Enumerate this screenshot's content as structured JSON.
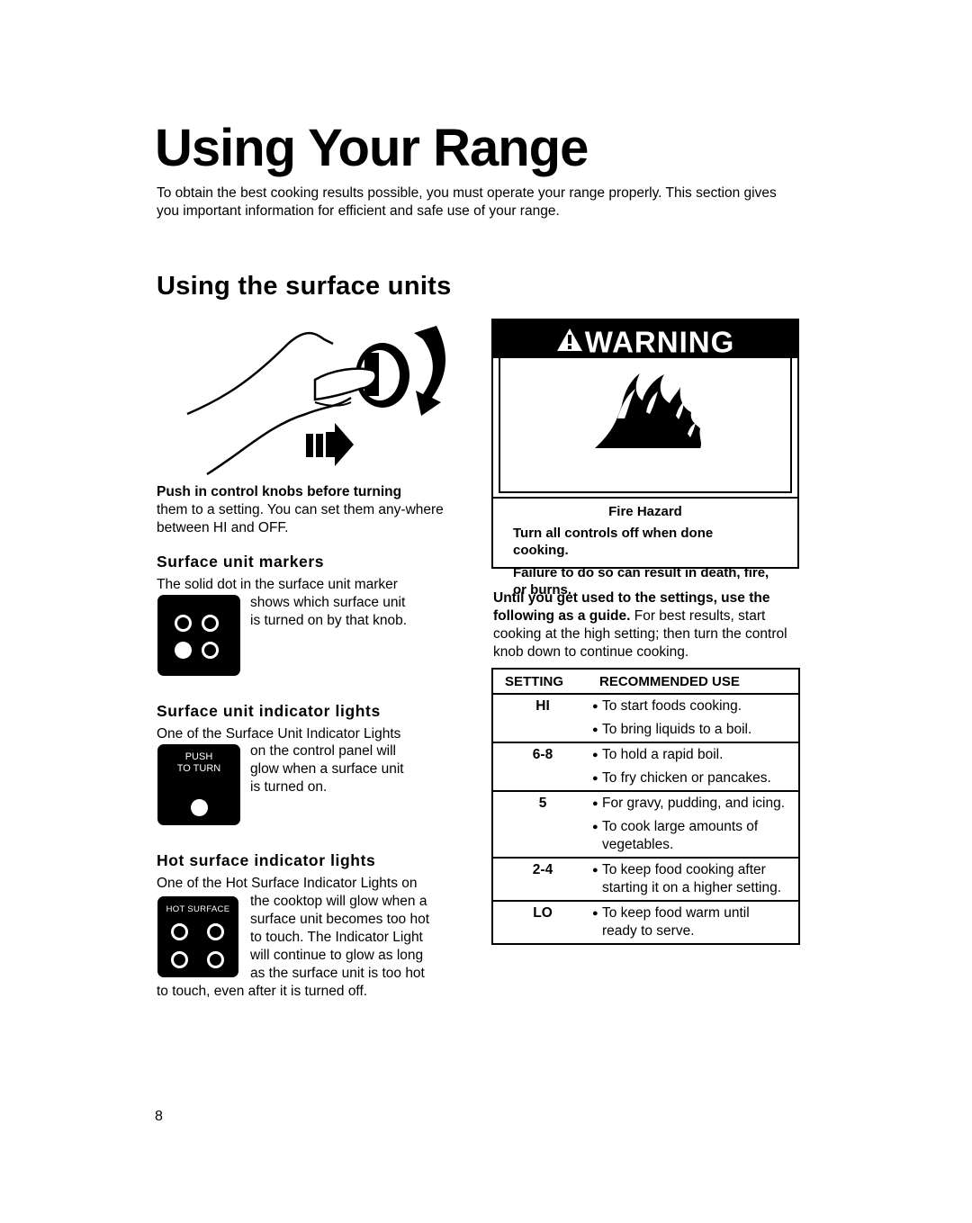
{
  "page": {
    "title": "Using Your Range",
    "intro": "To obtain the best cooking results possible, you must operate your range properly. This section gives you important information for efficient and safe use of your range.",
    "section_title": "Using the surface units",
    "page_number": "8"
  },
  "knob": {
    "illustration_icon": "hand-pushing-knob-icon",
    "caption_bold": "Push in control knobs before turning",
    "caption_rest": "them to a setting. You can set them any-where between HI and OFF."
  },
  "markers": {
    "heading": "Surface unit markers",
    "line1": "The solid dot in the surface unit marker",
    "line2": "shows which surface unit",
    "line3": "is turned on by that knob.",
    "icon": "surface-unit-marker-icon"
  },
  "indicator": {
    "heading": "Surface unit indicator lights",
    "line1": "One of the Surface Unit Indicator Lights",
    "line2": "on the control panel will",
    "line3": "glow when a surface unit",
    "line4": "is turned on.",
    "panel_label_1": "PUSH",
    "panel_label_2": "TO TURN"
  },
  "hot": {
    "heading": "Hot surface indicator lights",
    "line1": "One of the Hot Surface Indicator Lights on",
    "line2": "the cooktop will glow when a",
    "line3": "surface unit becomes too hot",
    "line4": "to touch. The Indicator Light",
    "line5": "will continue to glow as long",
    "line6": "as the surface unit is too hot",
    "line7": "to touch, even after it is turned off.",
    "panel_label": "HOT SURFACE"
  },
  "warning": {
    "header": "WARNING",
    "header_icon": "warning-triangle-icon",
    "image_icon": "fire-icon",
    "hazard": "Fire Hazard",
    "line1": "Turn all controls off when done cooking.",
    "line2": "Failure to do so can result in death, fire, or burns."
  },
  "guide": {
    "bold": "Until you get used to the settings, use the following as a guide.",
    "rest": " For best results, start cooking at the high setting; then turn the control knob down to continue cooking."
  },
  "table": {
    "headers": [
      "SETTING",
      "RECOMMENDED USE"
    ],
    "rows": [
      {
        "setting": "HI",
        "uses": [
          "To start foods cooking.",
          "To bring liquids to a boil."
        ]
      },
      {
        "setting": "6-8",
        "uses": [
          "To hold a rapid boil.",
          "To fry chicken or pancakes."
        ]
      },
      {
        "setting": "5",
        "uses": [
          "For gravy, pudding, and icing.",
          "To cook large amounts of vegetables."
        ]
      },
      {
        "setting": "2-4",
        "uses": [
          "To keep food cooking after starting it on a higher setting."
        ]
      },
      {
        "setting": "LO",
        "uses": [
          "To keep food warm until ready to serve."
        ]
      }
    ]
  }
}
